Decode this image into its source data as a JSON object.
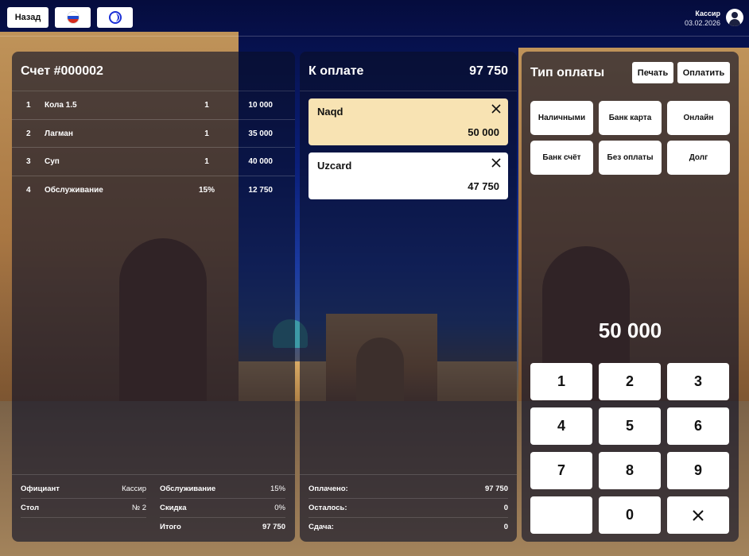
{
  "topbar": {
    "back_label": "Назад",
    "lang_flag": "russia-flag-icon",
    "theme_icon": "theme-toggle-icon",
    "user_role": "Кассир",
    "user_date": "03.02.2026"
  },
  "bill": {
    "title": "Счет #000002",
    "items": [
      {
        "num": "1",
        "name": "Кола 1.5",
        "qty": "1",
        "sum": "10 000"
      },
      {
        "num": "2",
        "name": "Лагман",
        "qty": "1",
        "sum": "35 000"
      },
      {
        "num": "3",
        "name": "Суп",
        "qty": "1",
        "sum": "40 000"
      },
      {
        "num": "4",
        "name": "Обслуживание",
        "qty": "15%",
        "sum": "12 750"
      }
    ],
    "footer": {
      "waiter_label": "Официант",
      "waiter_value": "Кассир",
      "table_label": "Стол",
      "table_value": "№ 2",
      "service_label": "Обслуживание",
      "service_value": "15%",
      "discount_label": "Скидка",
      "discount_value": "0%",
      "total_label": "Итого",
      "total_value": "97 750"
    }
  },
  "payment": {
    "title": "К оплате",
    "total": "97 750",
    "entries": [
      {
        "name": "Naqd",
        "amount": "50 000",
        "active": true
      },
      {
        "name": "Uzcard",
        "amount": "47 750",
        "active": false
      }
    ],
    "footer": {
      "paid_label": "Оплачено:",
      "paid_value": "97 750",
      "remaining_label": "Осталось:",
      "remaining_value": "0",
      "change_label": "Сдача:",
      "change_value": "0"
    }
  },
  "payment_types": {
    "title": "Тип оплаты",
    "print_label": "Печать",
    "pay_label": "Оплатить",
    "types": [
      "Наличными",
      "Банк карта",
      "Онлайн",
      "Банк счёт",
      "Без оплаты",
      "Долг"
    ],
    "amount": "50 000",
    "keys": [
      "1",
      "2",
      "3",
      "4",
      "5",
      "6",
      "7",
      "8",
      "9",
      "",
      "0"
    ]
  },
  "colors": {
    "active_payment": "#f8e3b3",
    "panel_bg": "rgba(10,14,38,0.62)"
  }
}
